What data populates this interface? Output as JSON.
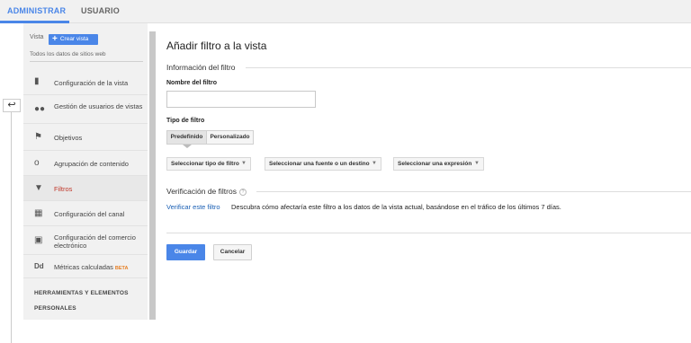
{
  "tabs": [
    {
      "label": "ADMINISTRAR",
      "active": true
    },
    {
      "label": "USUARIO",
      "active": false
    }
  ],
  "sidebar": {
    "vista_label": "Vista",
    "crear_vista_label": "Crear vista",
    "all_data_label": "Todos los datos de sitios web",
    "items": [
      {
        "label": "Configuración de la vista",
        "icon": "document-icon"
      },
      {
        "label": "Gestión de usuarios de vistas",
        "icon": "users-icon"
      },
      {
        "label": "Objetivos",
        "icon": "flag-icon"
      },
      {
        "label": "Agrupación de contenido",
        "icon": "grouping-icon"
      },
      {
        "label": "Filtros",
        "icon": "filter-icon",
        "selected": true
      },
      {
        "label": "Configuración del canal",
        "icon": "channel-icon"
      },
      {
        "label": "Configuración del comercio electrónico",
        "icon": "cart-icon"
      },
      {
        "label": "Métricas calculadas",
        "icon": "dd-icon",
        "badge": "BETA"
      }
    ],
    "section_line1": "HERRAMIENTAS Y ELEMENTOS",
    "section_line2": "PERSONALES"
  },
  "main": {
    "title": "Añadir filtro a la vista",
    "info_section": "Información del filtro",
    "name_label": "Nombre del filtro",
    "name_value": "",
    "type_label": "Tipo de filtro",
    "type_options": [
      "Predefinido",
      "Personalizado"
    ],
    "type_selected": "Predefinido",
    "dropdowns": [
      "Seleccionar tipo de filtro",
      "Seleccionar una fuente o un destino",
      "Seleccionar una expresión"
    ],
    "verify_section": "Verificación de filtros",
    "help_glyph": "?",
    "verify_link": "Verificar este filtro",
    "verify_desc": "Descubra cómo afectaría este filtro a los datos de la vista actual, basándose en el tráfico de los últimos 7 días.",
    "save_label": "Guardar",
    "cancel_label": "Cancelar"
  },
  "colors": {
    "accent": "#4a86e8",
    "selected_text": "#c0392b",
    "beta": "#e67e22",
    "link": "#1a5fb4"
  }
}
